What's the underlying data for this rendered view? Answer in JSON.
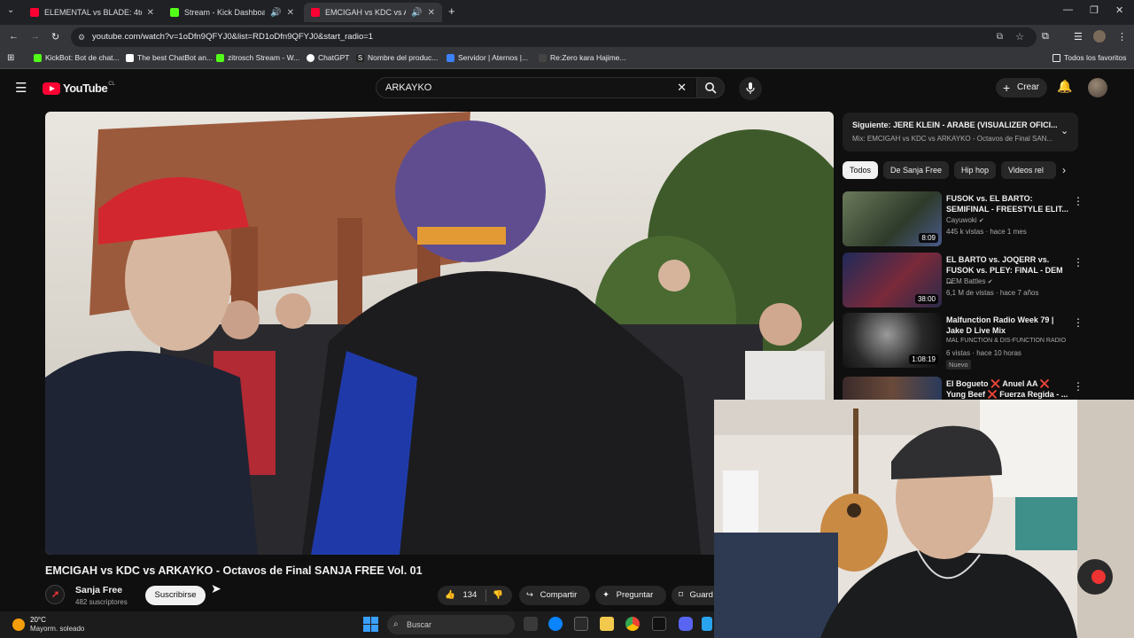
{
  "browser": {
    "tabs": [
      {
        "title": "ELEMENTAL vs BLADE: 4tos - D",
        "active": false,
        "favicon_color": "#ff0033"
      },
      {
        "title": "Stream - Kick Dashboard",
        "active": false,
        "favicon_color": "#53fc18"
      },
      {
        "title": "EMCIGAH vs KDC vs ARKAY",
        "active": true,
        "favicon_color": "#ff0033"
      }
    ],
    "url": "youtube.com/watch?v=1oDfn9QFYJ0&list=RD1oDfn9QFYJ0&start_radio=1",
    "bookmarks": [
      {
        "label": "KickBot: Bot de chat...",
        "color": "#53fc18"
      },
      {
        "label": "The best ChatBot an...",
        "color": "#ffffff"
      },
      {
        "label": "zitrosch Stream - W...",
        "color": "#53fc18"
      },
      {
        "label": "ChatGPT",
        "color": "#ffffff"
      },
      {
        "label": "Nombre del produc...",
        "color": "#222222"
      },
      {
        "label": "Servidor | Aternos |...",
        "color": "#3b82f6"
      },
      {
        "label": "Re:Zero kara Hajime...",
        "color": "#444444"
      }
    ],
    "all_bookmarks": "Todos los favoritos"
  },
  "youtube": {
    "logo": "YouTube",
    "logo_region": "CL",
    "search_value": "ARKAYKO",
    "create_label": "Crear",
    "video": {
      "title": "EMCIGAH vs KDC vs ARKAYKO - Octavos de Final SANJA FREE Vol. 01",
      "channel": "Sanja Free",
      "subscribers": "482 suscriptores",
      "subscribe_label": "Suscribirse",
      "likes": "134",
      "share_label": "Compartir",
      "ask_label": "Preguntar",
      "save_label": "Guard"
    },
    "up_next": {
      "title": "Siguiente: JERE KLEIN - ARABE (VISUALIZER OFICI...",
      "subtitle": "Mix: EMCIGAH vs KDC vs ARKAYKO - Octavos de Final SAN..."
    },
    "chips": [
      "Todos",
      "De Sanja Free",
      "Hip hop",
      "Videos rel"
    ],
    "related": [
      {
        "title": "FUSOK vs. EL BARTO: SEMIFINAL - FREESTYLE ELIT...",
        "channel": "Cayuwoki",
        "meta": "445 k vistas · hace 1 mes",
        "duration": "8:09",
        "badge": ""
      },
      {
        "title": "EL BARTO vs. JOQERR vs. FUSOK vs. PLEY: FINAL - DEM ...",
        "channel": "DEM Battles",
        "meta": "6,1 M de vistas · hace 7 años",
        "duration": "38:00",
        "badge": ""
      },
      {
        "title": "Malfunction Radio Week 79 | Jake D Live Mix",
        "channel": "MAL FUNCTION & DIS-FUNCTION RADIO",
        "meta": "6 vistas · hace 10 horas",
        "duration": "1:08:19",
        "badge": "Nuevo"
      },
      {
        "title": "El Bogueto ❌ Anuel AA ❌ Yung Beef ❌ Fuerza Regida - ...",
        "channel": "",
        "meta": "",
        "duration": "",
        "badge": ""
      }
    ]
  },
  "taskbar": {
    "temperature": "20°C",
    "weather": "Mayorm. soleado",
    "search_placeholder": "Buscar"
  }
}
